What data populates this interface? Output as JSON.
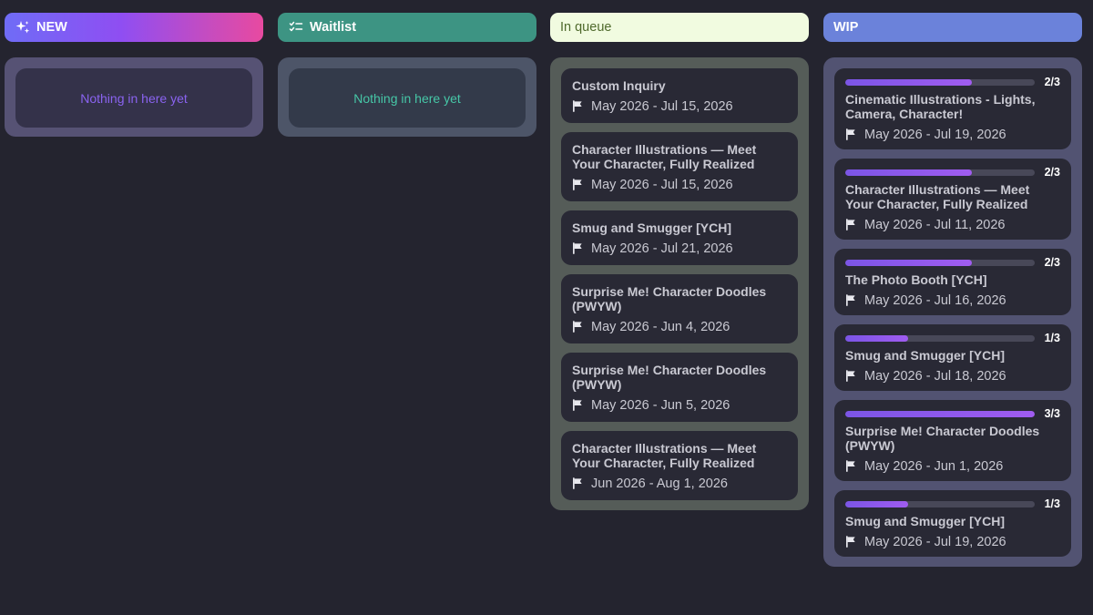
{
  "columns": {
    "new": {
      "title": "NEW",
      "empty_text": "Nothing in here yet"
    },
    "waitlist": {
      "title": "Waitlist",
      "empty_text": "Nothing in here yet"
    },
    "queue": {
      "title": "In queue",
      "cards": [
        {
          "title": "Custom Inquiry",
          "date": "May 2026 - Jul 15, 2026"
        },
        {
          "title": "Character Illustrations — Meet Your Character, Fully Realized",
          "date": "May 2026 - Jul 15, 2026"
        },
        {
          "title": "Smug and Smugger [YCH]",
          "date": "May 2026 - Jul 21, 2026"
        },
        {
          "title": "Surprise Me! Character Doodles (PWYW)",
          "date": "May 2026 - Jun 4, 2026"
        },
        {
          "title": "Surprise Me! Character Doodles (PWYW)",
          "date": "May 2026 - Jun 5, 2026"
        },
        {
          "title": "Character Illustrations — Meet Your Character, Fully Realized",
          "date": "Jun 2026 - Aug 1, 2026"
        }
      ]
    },
    "wip": {
      "title": "WIP",
      "cards": [
        {
          "progress": "2/3",
          "progress_fraction": 0.667,
          "title": "Cinematic Illustrations - Lights, Camera, Character!",
          "date": "May 2026 - Jul 19, 2026"
        },
        {
          "progress": "2/3",
          "progress_fraction": 0.667,
          "title": "Character Illustrations — Meet Your Character, Fully Realized",
          "date": "May 2026 - Jul 11, 2026"
        },
        {
          "progress": "2/3",
          "progress_fraction": 0.667,
          "title": "The Photo Booth [YCH]",
          "date": "May 2026 - Jul 16, 2026"
        },
        {
          "progress": "1/3",
          "progress_fraction": 0.333,
          "title": "Smug and Smugger [YCH]",
          "date": "May 2026 - Jul 18, 2026"
        },
        {
          "progress": "3/3",
          "progress_fraction": 1.0,
          "title": "Surprise Me! Character Doodles (PWYW)",
          "date": "May 2026 - Jun 1, 2026"
        },
        {
          "progress": "1/3",
          "progress_fraction": 0.333,
          "title": "Smug and Smugger [YCH]",
          "date": "May 2026 - Jul 19, 2026"
        }
      ]
    }
  },
  "icons": {
    "new": "sparkle-icon",
    "waitlist": "checklist-icon",
    "date": "flag-icon"
  },
  "colors": {
    "background": "#24242f",
    "accent_purple": "#8a63f0",
    "waitlist_green": "#3d9483",
    "wip_blue": "#6b82da",
    "queue_header": "#f1fbe0"
  }
}
